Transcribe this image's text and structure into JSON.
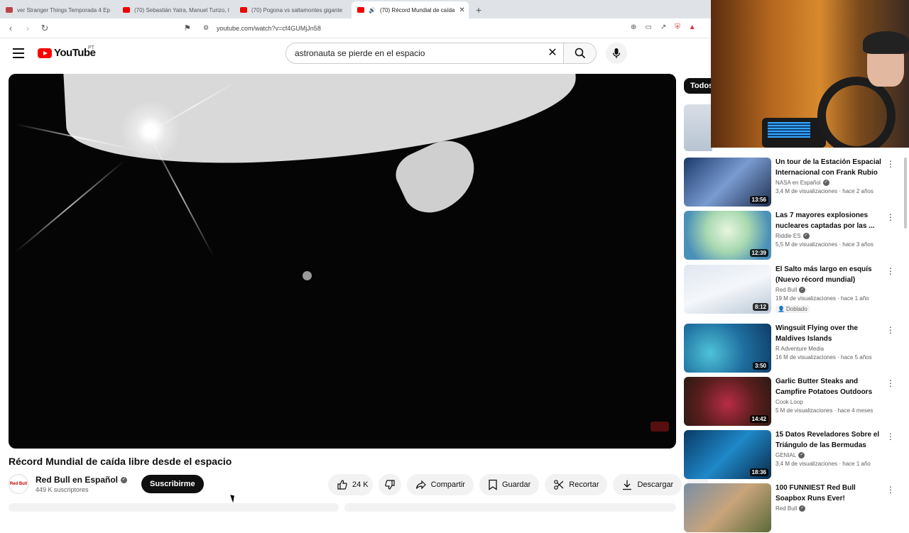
{
  "browser": {
    "tabs": [
      {
        "label": "ver Stranger Things Temporada 4 Ep"
      },
      {
        "label": "(70) Sebastián Yatra, Manuel Turizo, I"
      },
      {
        "label": "(70) Pogona vs saltamontes gigante"
      },
      {
        "label": "(70) Récord Mundial de caída",
        "close": "✕"
      }
    ],
    "new_tab": "+",
    "url": "youtube.com/watch?v=cf4GUMjJn58"
  },
  "youtube": {
    "logo_text": "YouTube",
    "logo_country": "PT",
    "search": {
      "value": "astronauta se pierde en el espacio",
      "clear": "✕"
    },
    "video": {
      "title": "Récord Mundial de caída libre desde el espacio",
      "channel": "Red Bull en Español",
      "subscribers": "449 K suscriptores",
      "subscribe_label": "Suscribirme",
      "avatar_text": "Red Bull",
      "likes": "24 K",
      "share": "Compartir",
      "save": "Guardar",
      "clip": "Recortar",
      "download": "Descargar"
    },
    "chip": "Todos",
    "recommendations": [
      {
        "title": "Un tour de la Estación Espacial Internacional con Frank Rubio",
        "channel": "NASA en Español",
        "verified": true,
        "meta": "3,4 M de visualizaciones · hace 2 años",
        "duration": "13:56",
        "thumb": "linear-gradient(135deg,#1b3a6b,#7a9bd0 50%,#203050)"
      },
      {
        "title": "Las 7 mayores explosiones nucleares captadas por las ...",
        "channel": "Riddle ES",
        "verified": true,
        "meta": "5,5 M de visualizaciones · hace 3 años",
        "duration": "12:39",
        "thumb": "radial-gradient(circle at 50% 40%,#e8f5e0,#a8d9b0 40%,#4a90b8 80%)"
      },
      {
        "title": "El Salto más largo en esquís (Nuevo récord mundial)",
        "channel": "Red Bull",
        "verified": true,
        "meta": "19 M de visualizaciones · hace 1 año",
        "badge": "Doblado",
        "duration": "8:12",
        "thumb": "linear-gradient(160deg,#dfe7f0,#f5f7fa 50%,#b9c8d8)"
      },
      {
        "title": "Wingsuit Flying over the Maldives Islands",
        "channel": "R Adventure Media",
        "verified": false,
        "meta": "16 M de visualizaciones · hace 5 años",
        "duration": "3:50",
        "thumb": "radial-gradient(circle at 30% 60%,#4fc3d8,#1f6fa0 50%,#0e3d66)"
      },
      {
        "title": "Garlic Butter Steaks and Campfire Potatoes Outdoors",
        "channel": "Cook Loop",
        "verified": false,
        "meta": "5 M de visualizaciones · hace 4 meses",
        "duration": "14:42",
        "thumb": "radial-gradient(circle at 50% 55%,#b82c44,#5a1e1e 55%,#2a1a12)"
      },
      {
        "title": "15 Datos Reveladores Sobre el Triángulo de las Bermudas",
        "channel": "GENIAL",
        "verified": true,
        "meta": "3,4 M de visualizaciones · hace 1 año",
        "duration": "18:36",
        "thumb": "linear-gradient(135deg,#0a3a66,#1e88c8 50%,#0b2a4a)"
      },
      {
        "title": "100 FUNNIEST Red Bull Soapbox Runs Ever!",
        "channel": "Red Bull",
        "verified": true,
        "meta": "",
        "duration": "",
        "thumb": "linear-gradient(135deg,#7a8fa6,#c9a47a 50%,#5a6a3a)"
      }
    ]
  }
}
